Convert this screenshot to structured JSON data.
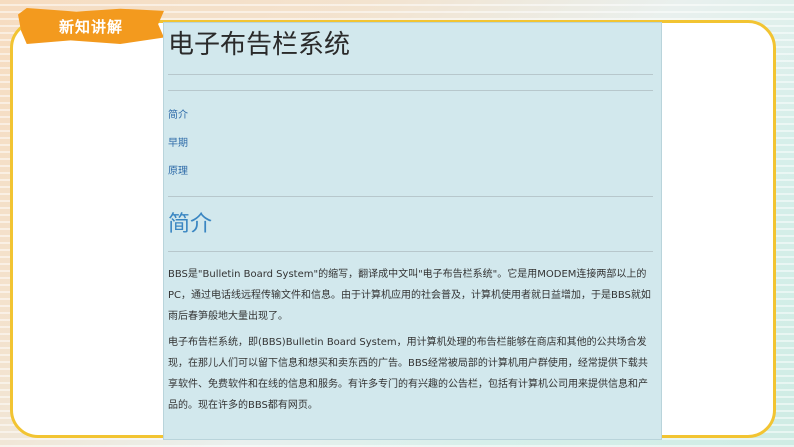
{
  "badge": {
    "label": "新知讲解"
  },
  "article": {
    "title": "电子布告栏系统",
    "toc": [
      "简介",
      "早期",
      "原理"
    ],
    "section_title": "简介",
    "paragraphs": [
      "BBS是\"Bulletin Board System\"的缩写，翻译成中文叫\"电子布告栏系统\"。它是用MODEM连接两部以上的PC，通过电话线远程传输文件和信息。由于计算机应用的社会普及，计算机使用者就日益增加，于是BBS就如雨后春笋般地大量出现了。",
      "电子布告栏系统，即(BBS)Bulletin Board System，用计算机处理的布告栏能够在商店和其他的公共场合发现，在那儿人们可以留下信息和想买和卖东西的广告。BBS经常被局部的计算机用户群使用，经常提供下载共享软件、免费软件和在线的信息和服务。有许多专门的有兴趣的公告栏，包括有计算机公司用来提供信息和产品的。现在许多的BBS都有网页。"
    ]
  },
  "colors": {
    "accent_orange": "#f39a1e",
    "frame_yellow": "#f2c432",
    "article_bg": "#d2e8ed",
    "link_blue": "#2d6aa8",
    "heading_blue": "#3a86c2"
  }
}
